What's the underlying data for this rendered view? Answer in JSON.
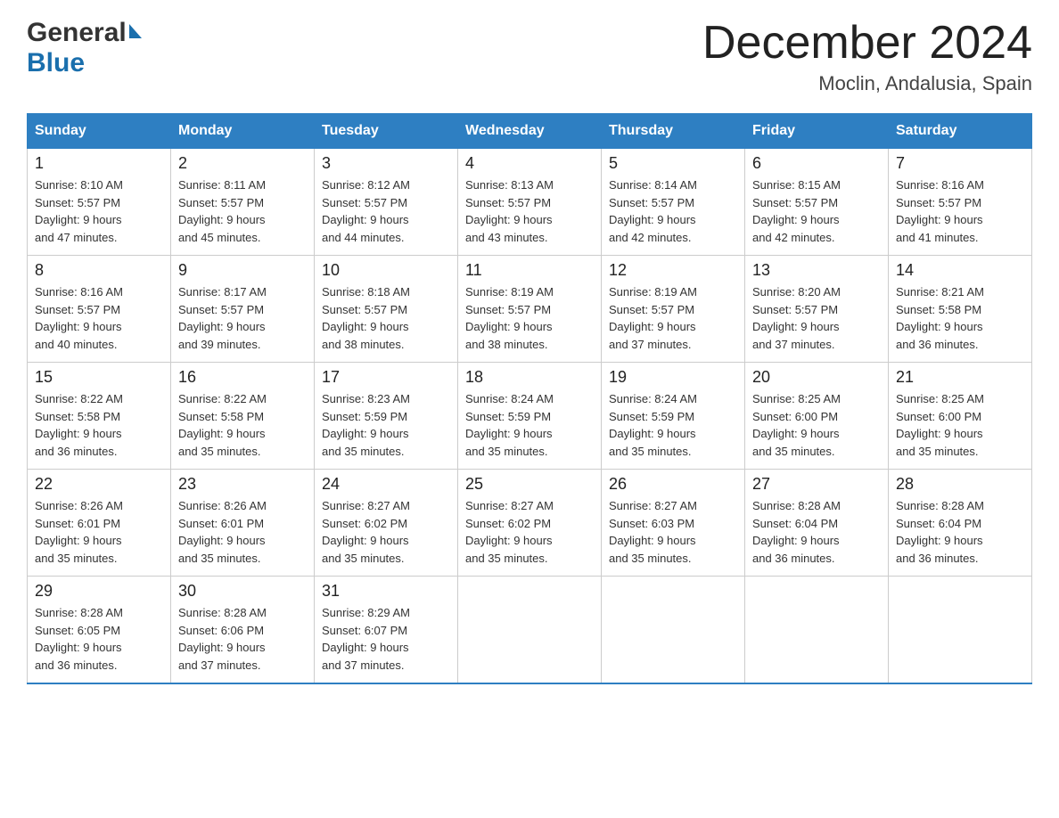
{
  "logo": {
    "line1": "General",
    "line2": "Blue"
  },
  "title": {
    "main": "December 2024",
    "sub": "Moclin, Andalusia, Spain"
  },
  "days_header": [
    "Sunday",
    "Monday",
    "Tuesday",
    "Wednesday",
    "Thursday",
    "Friday",
    "Saturday"
  ],
  "weeks": [
    [
      {
        "day": "1",
        "info": "Sunrise: 8:10 AM\nSunset: 5:57 PM\nDaylight: 9 hours\nand 47 minutes."
      },
      {
        "day": "2",
        "info": "Sunrise: 8:11 AM\nSunset: 5:57 PM\nDaylight: 9 hours\nand 45 minutes."
      },
      {
        "day": "3",
        "info": "Sunrise: 8:12 AM\nSunset: 5:57 PM\nDaylight: 9 hours\nand 44 minutes."
      },
      {
        "day": "4",
        "info": "Sunrise: 8:13 AM\nSunset: 5:57 PM\nDaylight: 9 hours\nand 43 minutes."
      },
      {
        "day": "5",
        "info": "Sunrise: 8:14 AM\nSunset: 5:57 PM\nDaylight: 9 hours\nand 42 minutes."
      },
      {
        "day": "6",
        "info": "Sunrise: 8:15 AM\nSunset: 5:57 PM\nDaylight: 9 hours\nand 42 minutes."
      },
      {
        "day": "7",
        "info": "Sunrise: 8:16 AM\nSunset: 5:57 PM\nDaylight: 9 hours\nand 41 minutes."
      }
    ],
    [
      {
        "day": "8",
        "info": "Sunrise: 8:16 AM\nSunset: 5:57 PM\nDaylight: 9 hours\nand 40 minutes."
      },
      {
        "day": "9",
        "info": "Sunrise: 8:17 AM\nSunset: 5:57 PM\nDaylight: 9 hours\nand 39 minutes."
      },
      {
        "day": "10",
        "info": "Sunrise: 8:18 AM\nSunset: 5:57 PM\nDaylight: 9 hours\nand 38 minutes."
      },
      {
        "day": "11",
        "info": "Sunrise: 8:19 AM\nSunset: 5:57 PM\nDaylight: 9 hours\nand 38 minutes."
      },
      {
        "day": "12",
        "info": "Sunrise: 8:19 AM\nSunset: 5:57 PM\nDaylight: 9 hours\nand 37 minutes."
      },
      {
        "day": "13",
        "info": "Sunrise: 8:20 AM\nSunset: 5:57 PM\nDaylight: 9 hours\nand 37 minutes."
      },
      {
        "day": "14",
        "info": "Sunrise: 8:21 AM\nSunset: 5:58 PM\nDaylight: 9 hours\nand 36 minutes."
      }
    ],
    [
      {
        "day": "15",
        "info": "Sunrise: 8:22 AM\nSunset: 5:58 PM\nDaylight: 9 hours\nand 36 minutes."
      },
      {
        "day": "16",
        "info": "Sunrise: 8:22 AM\nSunset: 5:58 PM\nDaylight: 9 hours\nand 35 minutes."
      },
      {
        "day": "17",
        "info": "Sunrise: 8:23 AM\nSunset: 5:59 PM\nDaylight: 9 hours\nand 35 minutes."
      },
      {
        "day": "18",
        "info": "Sunrise: 8:24 AM\nSunset: 5:59 PM\nDaylight: 9 hours\nand 35 minutes."
      },
      {
        "day": "19",
        "info": "Sunrise: 8:24 AM\nSunset: 5:59 PM\nDaylight: 9 hours\nand 35 minutes."
      },
      {
        "day": "20",
        "info": "Sunrise: 8:25 AM\nSunset: 6:00 PM\nDaylight: 9 hours\nand 35 minutes."
      },
      {
        "day": "21",
        "info": "Sunrise: 8:25 AM\nSunset: 6:00 PM\nDaylight: 9 hours\nand 35 minutes."
      }
    ],
    [
      {
        "day": "22",
        "info": "Sunrise: 8:26 AM\nSunset: 6:01 PM\nDaylight: 9 hours\nand 35 minutes."
      },
      {
        "day": "23",
        "info": "Sunrise: 8:26 AM\nSunset: 6:01 PM\nDaylight: 9 hours\nand 35 minutes."
      },
      {
        "day": "24",
        "info": "Sunrise: 8:27 AM\nSunset: 6:02 PM\nDaylight: 9 hours\nand 35 minutes."
      },
      {
        "day": "25",
        "info": "Sunrise: 8:27 AM\nSunset: 6:02 PM\nDaylight: 9 hours\nand 35 minutes."
      },
      {
        "day": "26",
        "info": "Sunrise: 8:27 AM\nSunset: 6:03 PM\nDaylight: 9 hours\nand 35 minutes."
      },
      {
        "day": "27",
        "info": "Sunrise: 8:28 AM\nSunset: 6:04 PM\nDaylight: 9 hours\nand 36 minutes."
      },
      {
        "day": "28",
        "info": "Sunrise: 8:28 AM\nSunset: 6:04 PM\nDaylight: 9 hours\nand 36 minutes."
      }
    ],
    [
      {
        "day": "29",
        "info": "Sunrise: 8:28 AM\nSunset: 6:05 PM\nDaylight: 9 hours\nand 36 minutes."
      },
      {
        "day": "30",
        "info": "Sunrise: 8:28 AM\nSunset: 6:06 PM\nDaylight: 9 hours\nand 37 minutes."
      },
      {
        "day": "31",
        "info": "Sunrise: 8:29 AM\nSunset: 6:07 PM\nDaylight: 9 hours\nand 37 minutes."
      },
      {
        "day": "",
        "info": ""
      },
      {
        "day": "",
        "info": ""
      },
      {
        "day": "",
        "info": ""
      },
      {
        "day": "",
        "info": ""
      }
    ]
  ]
}
